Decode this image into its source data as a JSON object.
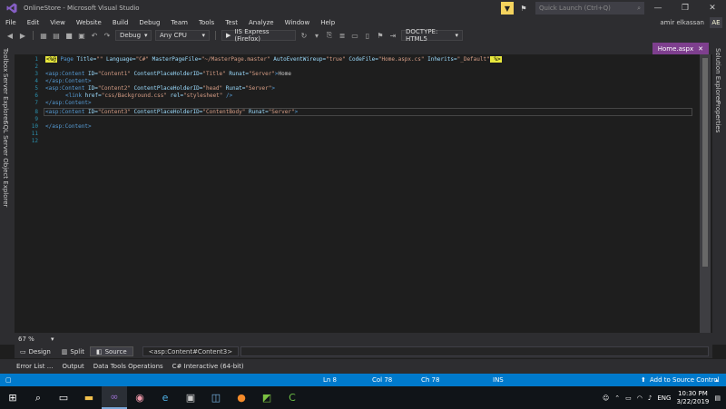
{
  "window": {
    "title": "OnlineStore - Microsoft Visual Studio",
    "quick_launch_placeholder": "Quick Launch (Ctrl+Q)"
  },
  "menu": [
    "File",
    "Edit",
    "View",
    "Website",
    "Build",
    "Debug",
    "Team",
    "Tools",
    "Test",
    "Analyze",
    "Window",
    "Help"
  ],
  "user": {
    "name": "amir elkassan",
    "initials": "AE"
  },
  "toolbar": {
    "configuration": "Debug",
    "platform": "Any CPU",
    "browser": "IIS Express (Firefox)",
    "doctype": "DOCTYPE: HTML5"
  },
  "side_tabs": {
    "left": [
      "Toolbox",
      "Server Explorer",
      "SQL Server Object Explorer"
    ],
    "right": [
      "Solution Explorer",
      "Properties"
    ]
  },
  "document": {
    "tab_label": "Home.aspx"
  },
  "editor": {
    "line_numbers": [
      "1",
      "2",
      "3",
      "4",
      "5",
      "6",
      "7",
      "8",
      "9",
      "10",
      "11",
      "12"
    ],
    "line1": {
      "directive_open": "<%@",
      "page_kw": " Page",
      "a1": " Title=",
      "v1": "\"\"",
      "a2": " Language=",
      "v2": "\"C#\"",
      "a3": " MasterPageFile=",
      "v3": "\"~/MasterPage.master\"",
      "a4": " AutoEventWireup=",
      "v4": "\"true\"",
      "a5": " CodeFile=",
      "v5": "\"Home.aspx.cs\"",
      "a6": " Inherits=",
      "v6": "\"_Default\"",
      "directive_close": " %>"
    },
    "line3": {
      "tag": "<asp:Content",
      "a1": " ID=",
      "v1": "\"Content1\"",
      "a2": " ContentPlaceHolderID=",
      "v2": "\"Title\"",
      "a3": " Runat=",
      "v3": "\"Server\"",
      "close": ">",
      "text": "Home"
    },
    "line4": {
      "tag": "</asp:Content>"
    },
    "line5": {
      "tag": "<asp:Content",
      "a1": " ID=",
      "v1": "\"Content2\"",
      "a2": " ContentPlaceHolderID=",
      "v2": "\"head\"",
      "a3": " Runat=",
      "v3": "\"Server\"",
      "close": ">"
    },
    "line6": {
      "tag": "<link",
      "a1": " href=",
      "v1": "\"css/Background.css\"",
      "a2": " rel=",
      "v2": "\"stylesheet\"",
      "close": " />"
    },
    "line7": {
      "tag": "</asp:Content>"
    },
    "line8": {
      "tag": "<asp:Content",
      "a1": " ID=",
      "v1": "\"Content3\"",
      "a2": " ContentPlaceHolderID=",
      "v2": "\"ContentBody\"",
      "a3": " Runat=",
      "v3": "\"Server\"",
      "close": ">"
    },
    "line10": {
      "tag": "</asp:Content>"
    }
  },
  "zoom": "67 %",
  "view_buttons": {
    "design": "Design",
    "split": "Split",
    "source": "Source"
  },
  "breadcrumb": "<asp:Content#Content3>",
  "tool_tabs": [
    "Error List ...",
    "Output",
    "Data Tools Operations",
    "C# Interactive (64-bit)"
  ],
  "status": {
    "ln": "Ln 8",
    "col": "Col 78",
    "ch": "Ch 78",
    "mode": "INS",
    "source_control": "Add to Source Control"
  },
  "tray": {
    "lang": "ENG",
    "time": "10:30 PM",
    "date": "3/22/2019"
  },
  "colors": {
    "accent": "#007acc",
    "tab": "#7e3f8e",
    "chrome": "#2d2d30",
    "editor_bg": "#1e1e1e"
  }
}
